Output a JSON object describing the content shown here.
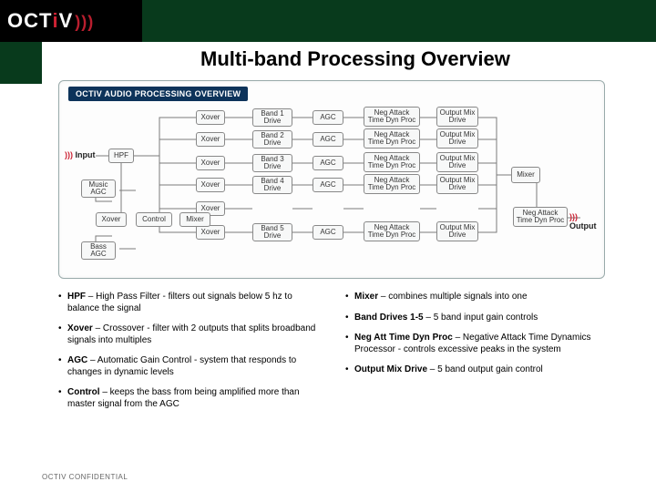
{
  "logo": {
    "textA": "OCT",
    "dot": "i",
    "textB": "V"
  },
  "page_title": "Multi-band Processing Overview",
  "diagram": {
    "title": "OCTIV AUDIO PROCESSING OVERVIEW",
    "input_label": "Input",
    "output_label": "Output",
    "hpf": "HPF",
    "xover": "Xover",
    "agc": "AGC",
    "mixer": "Mixer",
    "control": "Control",
    "music_agc": "Music AGC",
    "bass_agc": "Bass AGC",
    "band_drive": [
      "Band 1 Drive",
      "Band 2 Drive",
      "Band 3 Drive",
      "Band 4 Drive",
      "Band 5 Drive"
    ],
    "neg_att": "Neg Attack Time Dyn Proc",
    "out_mix": "Output Mix Drive",
    "final_neg": "Neg Attack Time Dyn Proc"
  },
  "defs_left": [
    {
      "term": "HPF",
      "text": " – High Pass Filter - filters out signals below 5 hz to balance the signal"
    },
    {
      "term": "Xover",
      "text": " – Crossover - filter with 2 outputs that splits broadband signals into multiples"
    },
    {
      "term": "AGC",
      "text": " – Automatic Gain Control - system that responds to changes in dynamic levels"
    },
    {
      "term": "Control",
      "text": " – keeps the bass from being amplified more than master signal from the AGC"
    }
  ],
  "defs_right": [
    {
      "term": "Mixer",
      "text": " – combines multiple signals into one"
    },
    {
      "term": "Band Drives 1-5",
      "text": " – 5 band input gain controls"
    },
    {
      "term": "Neg Att Time Dyn Proc",
      "text": " – Negative Attack Time Dynamics Processor - controls excessive peaks in the system"
    },
    {
      "term": "Output Mix Drive",
      "text": " – 5 band output gain control"
    }
  ],
  "footer": "OCTIV CONFIDENTIAL"
}
